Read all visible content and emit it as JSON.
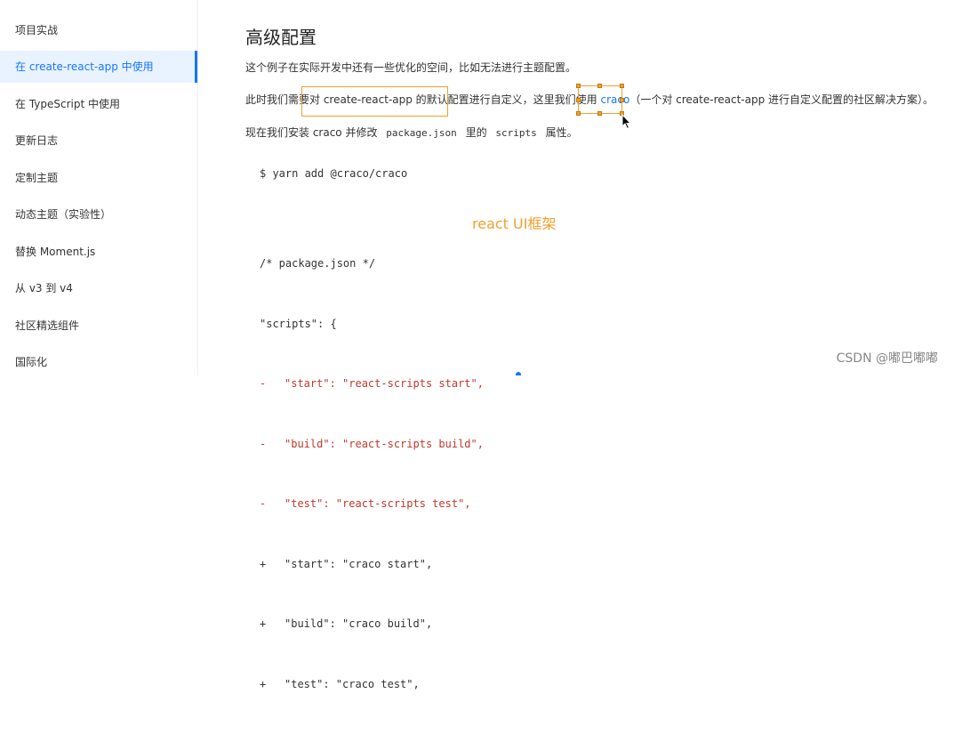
{
  "sidebar": {
    "items": [
      {
        "label": "项目实战",
        "active": false
      },
      {
        "label": "在 create-react-app 中使用",
        "active": true
      },
      {
        "label": "在 TypeScript 中使用",
        "active": false
      },
      {
        "label": "更新日志",
        "active": false
      },
      {
        "label": "定制主题",
        "active": false
      },
      {
        "label": "动态主题（实验性）",
        "active": false
      },
      {
        "label": "替换 Moment.js",
        "active": false
      },
      {
        "label": "从 v3 到 v4",
        "active": false
      },
      {
        "label": "社区精选组件",
        "active": false
      },
      {
        "label": "国际化",
        "active": false
      }
    ]
  },
  "main": {
    "title": "高级配置",
    "para1": "这个例子在实际开发中还有一些优化的空间，比如无法进行主题配置。",
    "para2": {
      "before": "此时我们需要对 create-react-app 的默认配置进行自定义，这里我们使用 ",
      "link": "craco",
      "after": "（一个对 create-react-app 进行自定义配置的社区解决方案）。"
    },
    "para3": {
      "before": "现在我们安装 craco 并修改 ",
      "code1": "package.json",
      "middle": " 里的 ",
      "code2": "scripts",
      "after": " 属性。"
    },
    "install_cmd": "$ yarn add @craco/craco",
    "code_lines": [
      {
        "mark": "",
        "text": "/* package.json */",
        "type": "normal"
      },
      {
        "mark": "",
        "text": "\"scripts\": {",
        "type": "normal"
      },
      {
        "mark": "-",
        "text": "\"start\": \"react-scripts start\",",
        "type": "removed"
      },
      {
        "mark": "-",
        "text": "\"build\": \"react-scripts build\",",
        "type": "removed"
      },
      {
        "mark": "-",
        "text": "\"test\": \"react-scripts test\",",
        "type": "removed"
      },
      {
        "mark": "+",
        "text": "\"start\": \"craco start\",",
        "type": "added"
      },
      {
        "mark": "+",
        "text": "\"build\": \"craco build\",",
        "type": "added"
      },
      {
        "mark": "+",
        "text": "\"test\": \"craco test\",",
        "type": "added"
      }
    ],
    "annotation": "react UI框架"
  },
  "watermark": "CSDN @嘟巴嘟嘟",
  "colors": {
    "accent": "#1677ff",
    "annotation": "#f0a030",
    "removed": "#c0392b"
  }
}
